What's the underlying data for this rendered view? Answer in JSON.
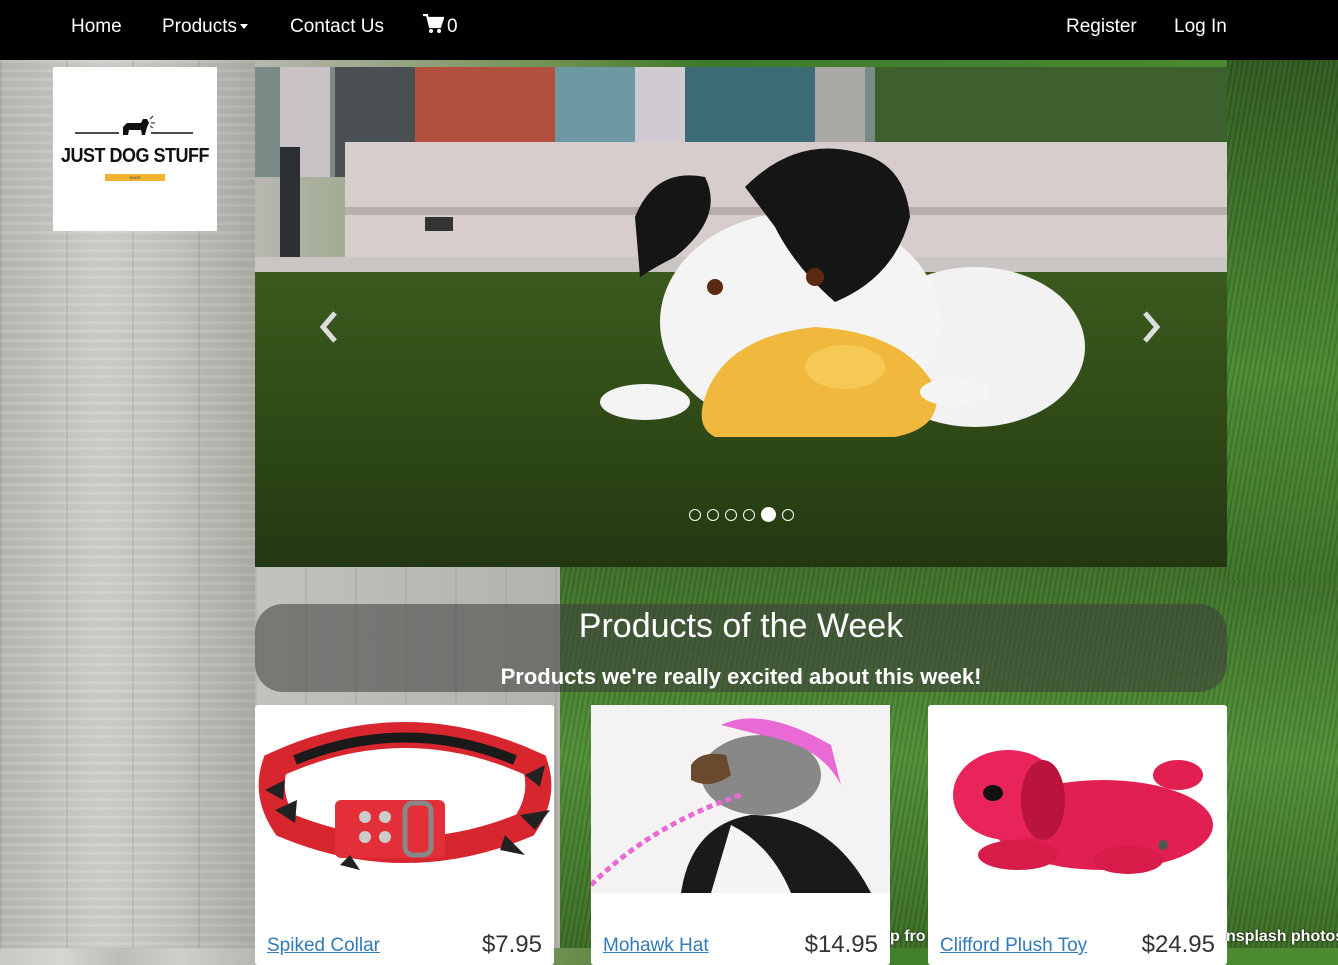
{
  "nav": {
    "home": "Home",
    "products": "Products",
    "contact": "Contact Us",
    "cart_count": "0",
    "register": "Register",
    "login": "Log In"
  },
  "logo": {
    "text": "JUST DOG STUFF",
    "sub": "SHOP"
  },
  "carousel": {
    "slide_count": 6,
    "active_index": 4
  },
  "products_section": {
    "title": "Products of the Week",
    "subtitle": "Products we're really excited about this week!"
  },
  "products": [
    {
      "name": "Spiked Collar",
      "price": "$7.95"
    },
    {
      "name": "Mohawk Hat",
      "price": "$14.95"
    },
    {
      "name": "Clifford Plush Toy",
      "price": "$24.95"
    }
  ],
  "credits": {
    "left": "p fro",
    "right": "nsplash photos"
  },
  "colors": {
    "navbar": "#000000",
    "link": "#337ab7",
    "accent": "#f2b233"
  }
}
